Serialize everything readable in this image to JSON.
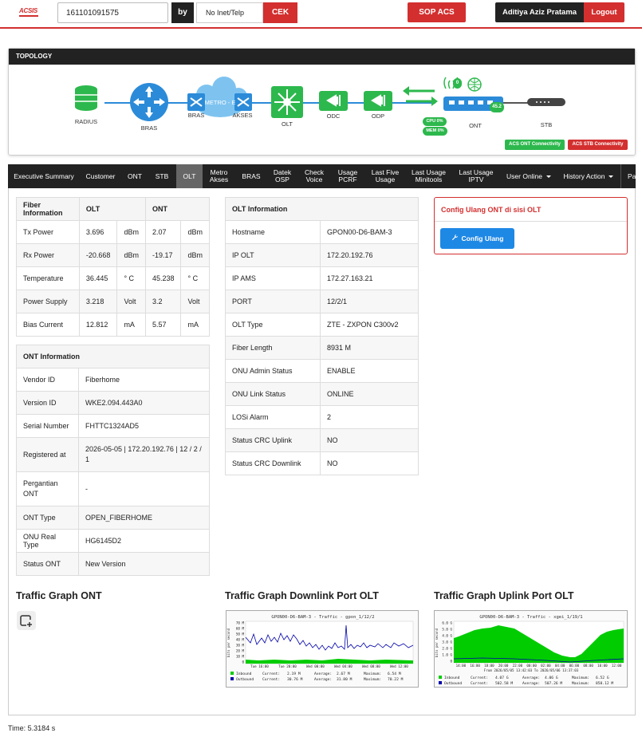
{
  "header": {
    "logo": "ACSIS",
    "search_value": "161101091575",
    "by_label": "by",
    "mode_select": "No Inet/Telp",
    "cek_label": "CEK",
    "sop_label": "SOP ACS",
    "user_name": "Aditiya Aziz Pratama",
    "logout_label": "Logout"
  },
  "topology": {
    "title": "TOPOLOGY",
    "nodes": {
      "radius": "RADIUS",
      "bras": "BRAS",
      "bras2": "BRAS",
      "metro": "METRO - E",
      "akses": "AKSES",
      "olt": "OLT",
      "odc": "ODC",
      "odp": "ODP",
      "ont": "ONT",
      "stb": "STB"
    },
    "ont_badge": "45.2",
    "wifi_badge": "0",
    "cpu_badge": "CPU 0%",
    "mem_badge": "MEM 0%",
    "acs_ont": "ACS ONT Connectivity",
    "acs_stb": "ACS STB Connectivity",
    "colors": {
      "ok": "#2db84d",
      "fail": "#d32f2f",
      "net": "#1e88e5"
    }
  },
  "nav": [
    {
      "label": "Executive Summary"
    },
    {
      "label": "Customer"
    },
    {
      "label": "ONT"
    },
    {
      "label": "STB"
    },
    {
      "label": "OLT"
    },
    {
      "label": "Metro Akses"
    },
    {
      "label": "BRAS"
    },
    {
      "label": "Datek OSP"
    },
    {
      "label": "Check Voice"
    },
    {
      "label": "Usage PCRF"
    },
    {
      "label": "Last Five Usage"
    },
    {
      "label": "Last Usage Minitools"
    },
    {
      "label": "Last Usage IPTV"
    },
    {
      "label": "User Online"
    },
    {
      "label": "History Action"
    },
    {
      "label": "Pa S"
    }
  ],
  "fiber": {
    "headers": [
      "Fiber Information",
      "OLT",
      "ONT"
    ],
    "rows": [
      [
        "Tx Power",
        "3.696",
        "dBm",
        "2.07",
        "dBm"
      ],
      [
        "Rx Power",
        "-20.668",
        "dBm",
        "-19.17",
        "dBm"
      ],
      [
        "Temperature",
        "36.445",
        "° C",
        "45.238",
        "° C"
      ],
      [
        "Power Supply",
        "3.218",
        "Volt",
        "3.2",
        "Volt"
      ],
      [
        "Bias Current",
        "12.812",
        "mA",
        "5.57",
        "mA"
      ]
    ]
  },
  "ont_info": {
    "header": "ONT Information",
    "rows": [
      [
        "Vendor ID",
        "Fiberhome"
      ],
      [
        "Version ID",
        "WKE2.094.443A0"
      ],
      [
        "Serial Number",
        "FHTTC1324AD5"
      ],
      [
        "Registered at",
        "2026-05-05 | 172.20.192.76 | 12 / 2 / 1"
      ],
      [
        "Pergantian ONT",
        "-"
      ],
      [
        "ONT Type",
        "OPEN_FIBERHOME"
      ],
      [
        "ONU Real Type",
        "HG6145D2"
      ],
      [
        "Status ONT",
        "New Version"
      ]
    ]
  },
  "olt_info": {
    "header": "OLT Information",
    "rows": [
      [
        "Hostname",
        "GPON00-D6-BAM-3"
      ],
      [
        "IP OLT",
        "172.20.192.76"
      ],
      [
        "IP AMS",
        "172.27.163.21"
      ],
      [
        "PORT",
        "12/2/1"
      ],
      [
        "OLT Type",
        "ZTE - ZXPON C300v2"
      ],
      [
        "Fiber Length",
        "8931 M"
      ],
      [
        "ONU Admin Status",
        "ENABLE"
      ],
      [
        "ONU Link Status",
        "ONLINE"
      ],
      [
        "LOSi Alarm",
        "2"
      ],
      [
        "Status CRC Uplink",
        "NO"
      ],
      [
        "Status CRC Downlink",
        "NO"
      ]
    ]
  },
  "config": {
    "title": "Config Ulang ONT di sisi OLT",
    "button": "Config Ulang"
  },
  "graphs": {
    "ont_title": "Traffic Graph ONT",
    "downlink_title": "Traffic Graph Downlink Port OLT",
    "uplink_title": "Traffic Graph Uplink Port OLT",
    "downlink": {
      "chart_title": "GPON00-D6-BAM-3 - Traffic - gpon_1/12/2",
      "ylabel": "bits per second",
      "yticks": [
        "70 M",
        "60 M",
        "50 M",
        "40 M",
        "30 M",
        "20 M",
        "10 M",
        "0"
      ],
      "xticks": [
        "Tue 16:00",
        "Tue 20:00",
        "Wed 00:00",
        "Wed 04:00",
        "Wed 08:00",
        "Wed 12:00"
      ],
      "legend": [
        [
          "Inbound",
          "Current:",
          "2.19 M",
          "Average:",
          "2.67 M",
          "Maximum:",
          "6.54 M"
        ],
        [
          "Outbound",
          "Current:",
          "30.76 M",
          "Average:",
          "31.80 M",
          "Maximum:",
          "70.22 M"
        ]
      ]
    },
    "uplink": {
      "chart_title": "GPON00-D6-BAM-3 - Traffic - xgei_1/19/1",
      "ylabel": "bits per second",
      "yticks": [
        "6.0 G",
        "5.0 G",
        "4.0 G",
        "3.0 G",
        "2.0 G",
        "1.0 G",
        "0"
      ],
      "xticks": [
        "14:00",
        "16:00",
        "18:00",
        "20:00",
        "22:00",
        "00:00",
        "02:00",
        "04:00",
        "06:00",
        "08:00",
        "10:00",
        "12:00"
      ],
      "range_note": "From 2026/05/05 13:42:03 To 2026/05/06 13:37:03",
      "legend": [
        [
          "Inbound",
          "Current:",
          "4.07 G",
          "Average:",
          "4.06 G",
          "Maximum:",
          "6.52 G"
        ],
        [
          "Outbound",
          "Current:",
          "502.58 M",
          "Average:",
          "507.26 M",
          "Maximum:",
          "858.12 M"
        ]
      ]
    }
  },
  "footer": {
    "time": "Time: 5.3184 s"
  }
}
